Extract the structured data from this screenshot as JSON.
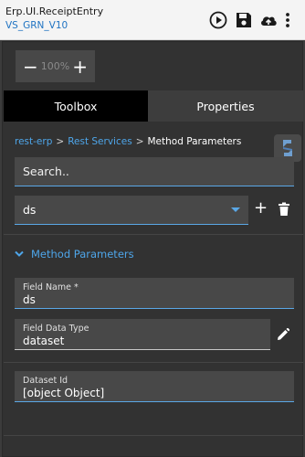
{
  "app": {
    "title": "Erp.UI.ReceiptEntry",
    "subtitle": "VS_GRN_V10"
  },
  "toolbar_icons": [
    "play-circle-icon",
    "save-icon",
    "cloud-upload-icon",
    "more-vertical-icon"
  ],
  "zoom": {
    "minus": "−",
    "value": "100%",
    "plus": "+"
  },
  "tabs": [
    {
      "label": "Toolbox",
      "active": true
    },
    {
      "label": "Properties",
      "active": false
    }
  ],
  "breadcrumb": {
    "items": [
      "rest-erp",
      "Rest Services",
      "Method Parameters"
    ],
    "separator": ">"
  },
  "search": {
    "placeholder": "Search.."
  },
  "selector": {
    "value": "ds",
    "add_label": "+"
  },
  "section": {
    "title": "Method Parameters",
    "expanded": true
  },
  "fields": [
    {
      "label": "Field Name *",
      "value": "ds"
    },
    {
      "label": "Field Data Type",
      "value": "dataset"
    },
    {
      "label": "Dataset Id",
      "value": "[object Object]"
    }
  ],
  "colors": {
    "accent": "#4ea6ea",
    "panel_bg": "#323232",
    "field_bg": "#484848",
    "active_tab": "#000000",
    "titlebar_bg": "#f4f4f4",
    "subtitle": "#1f73c2"
  }
}
